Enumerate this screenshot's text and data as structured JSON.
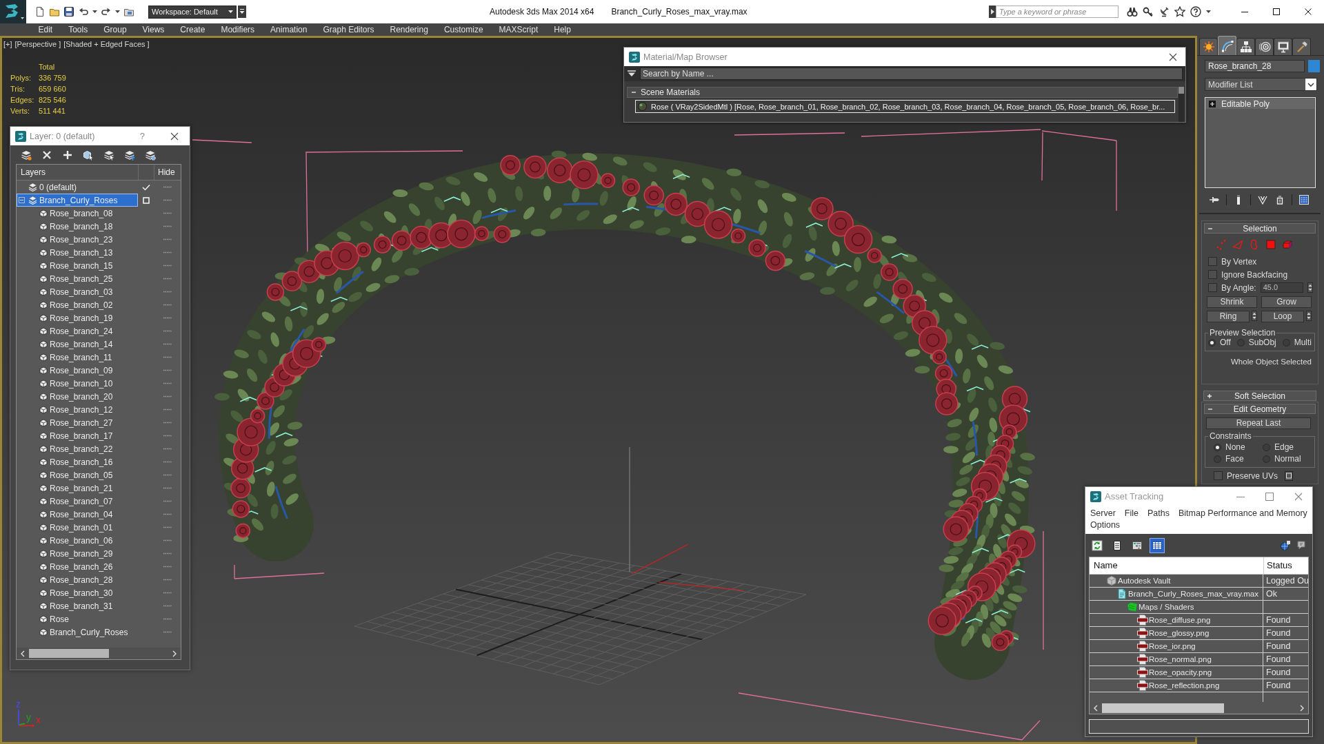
{
  "title_bar": {
    "workspace": "Workspace: Default",
    "app_title": "Autodesk 3ds Max 2014 x64",
    "file_name": "Branch_Curly_Roses_max_vray.max",
    "search": {
      "placeholder": "Type a keyword or phrase"
    }
  },
  "menu_bar": [
    "Edit",
    "Tools",
    "Group",
    "Views",
    "Create",
    "Modifiers",
    "Animation",
    "Graph Editors",
    "Rendering",
    "Customize",
    "MAXScript",
    "Help"
  ],
  "viewport": {
    "active": true,
    "labels": [
      "[+]",
      "[Perspective ]",
      "[Shaded + Edged Faces ]"
    ],
    "stats": {
      "heading": "Total",
      "rows": [
        {
          "label": "Polys:",
          "value": "336 759"
        },
        {
          "label": "Tris:",
          "value": "659 660"
        },
        {
          "label": "Edges:",
          "value": "825 546"
        },
        {
          "label": "Verts:",
          "value": "511 441"
        }
      ]
    },
    "axis_labels": [
      {
        "label": "z",
        "color": "#4848ff"
      },
      {
        "label": "y",
        "color": "#22a022"
      },
      {
        "label": "x",
        "color": "#e02020"
      }
    ]
  },
  "layer_dialog": {
    "title": "Layer: 0 (default)",
    "help_button": "?",
    "columns": [
      "Layers",
      "Hide"
    ],
    "layers": [
      {
        "name": "0 (default)",
        "current": true,
        "selected": false,
        "hidden": false
      },
      {
        "name": "Branch_Curly_Roses",
        "current": false,
        "selected": true,
        "hidden": false,
        "expanded": true,
        "children": [
          {
            "name": "Rose_branch_08",
            "hidden": false
          },
          {
            "name": "Rose_branch_18",
            "hidden": false
          },
          {
            "name": "Rose_branch_23",
            "hidden": false
          },
          {
            "name": "Rose_branch_13",
            "hidden": false
          },
          {
            "name": "Rose_branch_15",
            "hidden": false
          },
          {
            "name": "Rose_branch_25",
            "hidden": false
          },
          {
            "name": "Rose_branch_03",
            "hidden": false
          },
          {
            "name": "Rose_branch_02",
            "hidden": false
          },
          {
            "name": "Rose_branch_19",
            "hidden": false
          },
          {
            "name": "Rose_branch_24",
            "hidden": false
          },
          {
            "name": "Rose_branch_14",
            "hidden": false
          },
          {
            "name": "Rose_branch_11",
            "hidden": false
          },
          {
            "name": "Rose_branch_09",
            "hidden": false
          },
          {
            "name": "Rose_branch_10",
            "hidden": false
          },
          {
            "name": "Rose_branch_20",
            "hidden": false
          },
          {
            "name": "Rose_branch_12",
            "hidden": false
          },
          {
            "name": "Rose_branch_27",
            "hidden": false
          },
          {
            "name": "Rose_branch_17",
            "hidden": false
          },
          {
            "name": "Rose_branch_22",
            "hidden": false
          },
          {
            "name": "Rose_branch_16",
            "hidden": false
          },
          {
            "name": "Rose_branch_05",
            "hidden": false
          },
          {
            "name": "Rose_branch_21",
            "hidden": false
          },
          {
            "name": "Rose_branch_07",
            "hidden": false
          },
          {
            "name": "Rose_branch_04",
            "hidden": false
          },
          {
            "name": "Rose_branch_01",
            "hidden": false
          },
          {
            "name": "Rose_branch_06",
            "hidden": false
          },
          {
            "name": "Rose_branch_29",
            "hidden": false
          },
          {
            "name": "Rose_branch_26",
            "hidden": false
          },
          {
            "name": "Rose_branch_28",
            "hidden": false
          },
          {
            "name": "Rose_branch_30",
            "hidden": false
          },
          {
            "name": "Rose_branch_31",
            "hidden": false
          },
          {
            "name": "Rose",
            "hidden": false
          },
          {
            "name": "Branch_Curly_Roses",
            "hidden": false
          }
        ]
      }
    ]
  },
  "material_browser": {
    "title": "Material/Map Browser",
    "search": {
      "placeholder": "Search by Name ..."
    },
    "groups": [
      {
        "label": "Scene Materials",
        "expanded": true,
        "items": [
          {
            "name": "Rose ( VRay2SidedMtl ) [Rose, Rose_branch_01, Rose_branch_02, Rose_branch_03, Rose_branch_04, Rose_branch_05, Rose_branch_06, Rose_br...",
            "selected": true
          }
        ]
      }
    ]
  },
  "command_panel": {
    "tabs": [
      {
        "kind": "create",
        "selected": false
      },
      {
        "kind": "modify",
        "selected": true
      },
      {
        "kind": "hierarchy",
        "selected": false
      },
      {
        "kind": "motion",
        "selected": false
      },
      {
        "kind": "display",
        "selected": false
      },
      {
        "kind": "utilities",
        "selected": false
      }
    ],
    "object_name": "Rose_branch_28",
    "modifier_list": "Modifier List",
    "stack": [
      {
        "name": "Editable Poly",
        "expanded": false
      }
    ],
    "rollouts": [
      {
        "kind": "selection",
        "title": "Selection",
        "expanded": true,
        "levels": [
          {
            "kind": "vertex",
            "selected": false
          },
          {
            "kind": "edge",
            "selected": false
          },
          {
            "kind": "border",
            "selected": false
          },
          {
            "kind": "polygon",
            "selected": false
          },
          {
            "kind": "element",
            "selected": false
          }
        ],
        "options": [
          {
            "kind": "checkbox",
            "label": "By Vertex",
            "checked": false
          },
          {
            "kind": "checkbox",
            "label": "Ignore Backfacing",
            "checked": false
          },
          {
            "kind": "angle",
            "label": "By Angle:",
            "checked": false,
            "value": "45.0"
          }
        ],
        "buttons": [
          {
            "kind": "plain",
            "label": "Shrink"
          },
          {
            "kind": "plain",
            "label": "Grow"
          },
          {
            "kind": "spinner",
            "label": "Ring"
          },
          {
            "kind": "spinner",
            "label": "Loop"
          }
        ],
        "preview": {
          "label": "Preview Selection",
          "options": [
            {
              "label": "Off",
              "selected": true
            },
            {
              "label": "SubObj",
              "selected": false
            },
            {
              "label": "Multi",
              "selected": false
            }
          ]
        },
        "status": "Whole Object Selected"
      },
      {
        "kind": "soft_selection",
        "title": "Soft Selection",
        "expanded": false
      },
      {
        "kind": "edit_geometry",
        "title": "Edit Geometry",
        "expanded": true,
        "repeat_button": "Repeat Last",
        "constraints": {
          "label": "Constraints",
          "options": [
            {
              "label": "None",
              "selected": true
            },
            {
              "label": "Edge",
              "selected": false
            },
            {
              "label": "Face",
              "selected": false
            },
            {
              "label": "Normal",
              "selected": false
            }
          ]
        },
        "preserve_uvs": {
          "label": "Preserve UVs",
          "checked": false
        }
      }
    ]
  },
  "asset_tracking": {
    "title": "Asset Tracking",
    "menu": [
      "Server",
      "File",
      "Paths",
      "Bitmap Performance and Memory",
      "Options"
    ],
    "toolbar": [
      {
        "kind": "refresh",
        "selected": false
      },
      {
        "kind": "list",
        "selected": false
      },
      {
        "kind": "tree",
        "selected": false
      },
      {
        "kind": "table",
        "selected": true
      }
    ],
    "columns": [
      "Name",
      "Status"
    ],
    "assets": [
      {
        "kind": "vault",
        "name": "Autodesk Vault",
        "status": "Logged Ou",
        "children": [
          {
            "kind": "max_file",
            "name": "Branch_Curly_Roses_max_vray.max",
            "status": "Ok",
            "children": [
              {
                "kind": "folder",
                "name": "Maps / Shaders",
                "children": [
                  {
                    "kind": "png",
                    "name": "Rose_diffuse.png",
                    "status": "Found"
                  },
                  {
                    "kind": "png",
                    "name": "Rose_glossy.png",
                    "status": "Found"
                  },
                  {
                    "kind": "png",
                    "name": "Rose_ior.png",
                    "status": "Found"
                  },
                  {
                    "kind": "png",
                    "name": "Rose_normal.png",
                    "status": "Found"
                  },
                  {
                    "kind": "png",
                    "name": "Rose_opacity.png",
                    "status": "Found"
                  },
                  {
                    "kind": "png",
                    "name": "Rose_reflection.png",
                    "status": "Found"
                  }
                ]
              }
            ]
          }
        ]
      }
    ]
  }
}
